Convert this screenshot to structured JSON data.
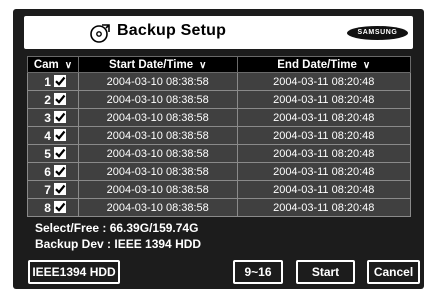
{
  "title": "Backup Setup",
  "brand": "SAMSUNG",
  "table": {
    "headers": {
      "cam": "Cam",
      "start": "Start Date/Time",
      "end": "End Date/Time",
      "caret": "∨"
    },
    "rows": [
      {
        "cam": "1",
        "start": "2004-03-10 08:38:58",
        "end": "2004-03-11 08:20:48"
      },
      {
        "cam": "2",
        "start": "2004-03-10 08:38:58",
        "end": "2004-03-11 08:20:48"
      },
      {
        "cam": "3",
        "start": "2004-03-10 08:38:58",
        "end": "2004-03-11 08:20:48"
      },
      {
        "cam": "4",
        "start": "2004-03-10 08:38:58",
        "end": "2004-03-11 08:20:48"
      },
      {
        "cam": "5",
        "start": "2004-03-10 08:38:58",
        "end": "2004-03-11 08:20:48"
      },
      {
        "cam": "6",
        "start": "2004-03-10 08:38:58",
        "end": "2004-03-11 08:20:48"
      },
      {
        "cam": "7",
        "start": "2004-03-10 08:38:58",
        "end": "2004-03-11 08:20:48"
      },
      {
        "cam": "8",
        "start": "2004-03-10 08:38:58",
        "end": "2004-03-11 08:20:48"
      }
    ]
  },
  "info": {
    "select_free": "Select/Free :  66.39G/159.74G",
    "backup_dev": "Backup Dev : IEEE 1394 HDD"
  },
  "buttons": {
    "device": "IEEE1394 HDD",
    "page": "9~16",
    "start": "Start",
    "cancel": "Cancel"
  },
  "icons": {
    "title": "backup-disc-icon",
    "checkbox": "checkbox-checked-icon"
  },
  "colors": {
    "background": "#1c1c1c",
    "row": "#404040",
    "header": "#000000",
    "titlebar": "#ffffff"
  }
}
